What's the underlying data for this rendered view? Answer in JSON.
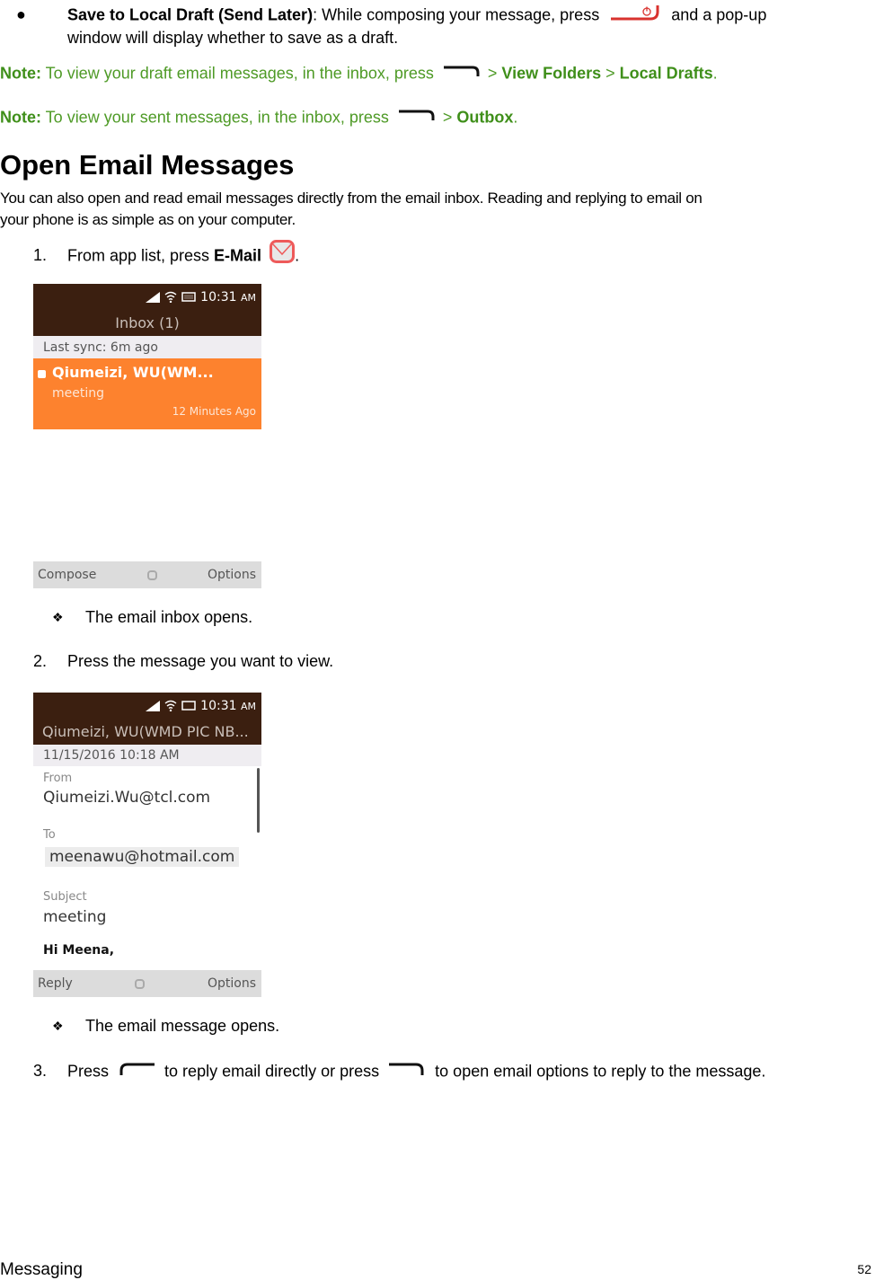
{
  "bullet_save_draft": {
    "marker": "●",
    "title": "Save to Local Draft (Send Later)",
    "text_before": ": While composing your message, press",
    "text_after": "and a pop-up",
    "line2": "window will display whether to save as a draft.",
    "key_icon": "power-end-key-icon"
  },
  "note1": {
    "label": "Note:",
    "text": " To view your draft email messages, in the inbox, press",
    "sep1": " > ",
    "item1": "View Folders",
    "sep2": " > ",
    "item2": "Local Drafts",
    "end": ".",
    "key_icon": "right-softkey-icon"
  },
  "note2": {
    "label": "Note:",
    "text": " To view your sent messages, in the inbox, press",
    "sep1": " > ",
    "item1": "Outbox",
    "end": ".",
    "key_icon": "right-softkey-icon"
  },
  "section": {
    "title": "Open Email Messages",
    "intro_line1": "You can also open and read email messages directly from the email inbox. Reading and replying to email on",
    "intro_line2": "your phone is as simple as on your computer."
  },
  "steps": [
    {
      "num": "1.",
      "text": "From app list, press ",
      "bold": "E-Mail",
      "end": ".",
      "icon": "email-app-icon"
    },
    {
      "num": "2.",
      "text": "Press the message you want to view."
    },
    {
      "num": "3.",
      "text_a": "Press",
      "text_b": "to reply email directly or press",
      "text_c": "to open email options to reply to the message."
    }
  ],
  "results": [
    {
      "marker": "❖",
      "text": "The email inbox opens."
    },
    {
      "marker": "❖",
      "text": "The email message opens."
    }
  ],
  "screen_inbox": {
    "status_time": "10:31",
    "status_ampm": "AM",
    "title": "Inbox (1)",
    "sync": "Last sync: 6m ago",
    "message": {
      "sender": "Qiumeizi, WU(WM...",
      "subject": "meeting",
      "time": "12 Minutes Ago"
    },
    "softkeys": {
      "left": "Compose",
      "right": "Options"
    },
    "colors": {
      "header": "#3b1f10",
      "highlight": "#fd822e"
    }
  },
  "screen_message": {
    "status_time": "10:31",
    "status_ampm": "AM",
    "title": "Qiumeizi, WU(WMD PIC NB...",
    "date": "11/15/2016 10:18 AM",
    "from_label": "From",
    "from_value": "Qiumeizi.Wu@tcl.com",
    "to_label": "To",
    "to_value": "meenawu@hotmail.com",
    "subject_label": "Subject",
    "subject_value": "meeting",
    "body": "Hi Meena,",
    "softkeys": {
      "left": "Reply",
      "right": "Options"
    }
  },
  "footer": {
    "section": "Messaging",
    "page": "52"
  }
}
